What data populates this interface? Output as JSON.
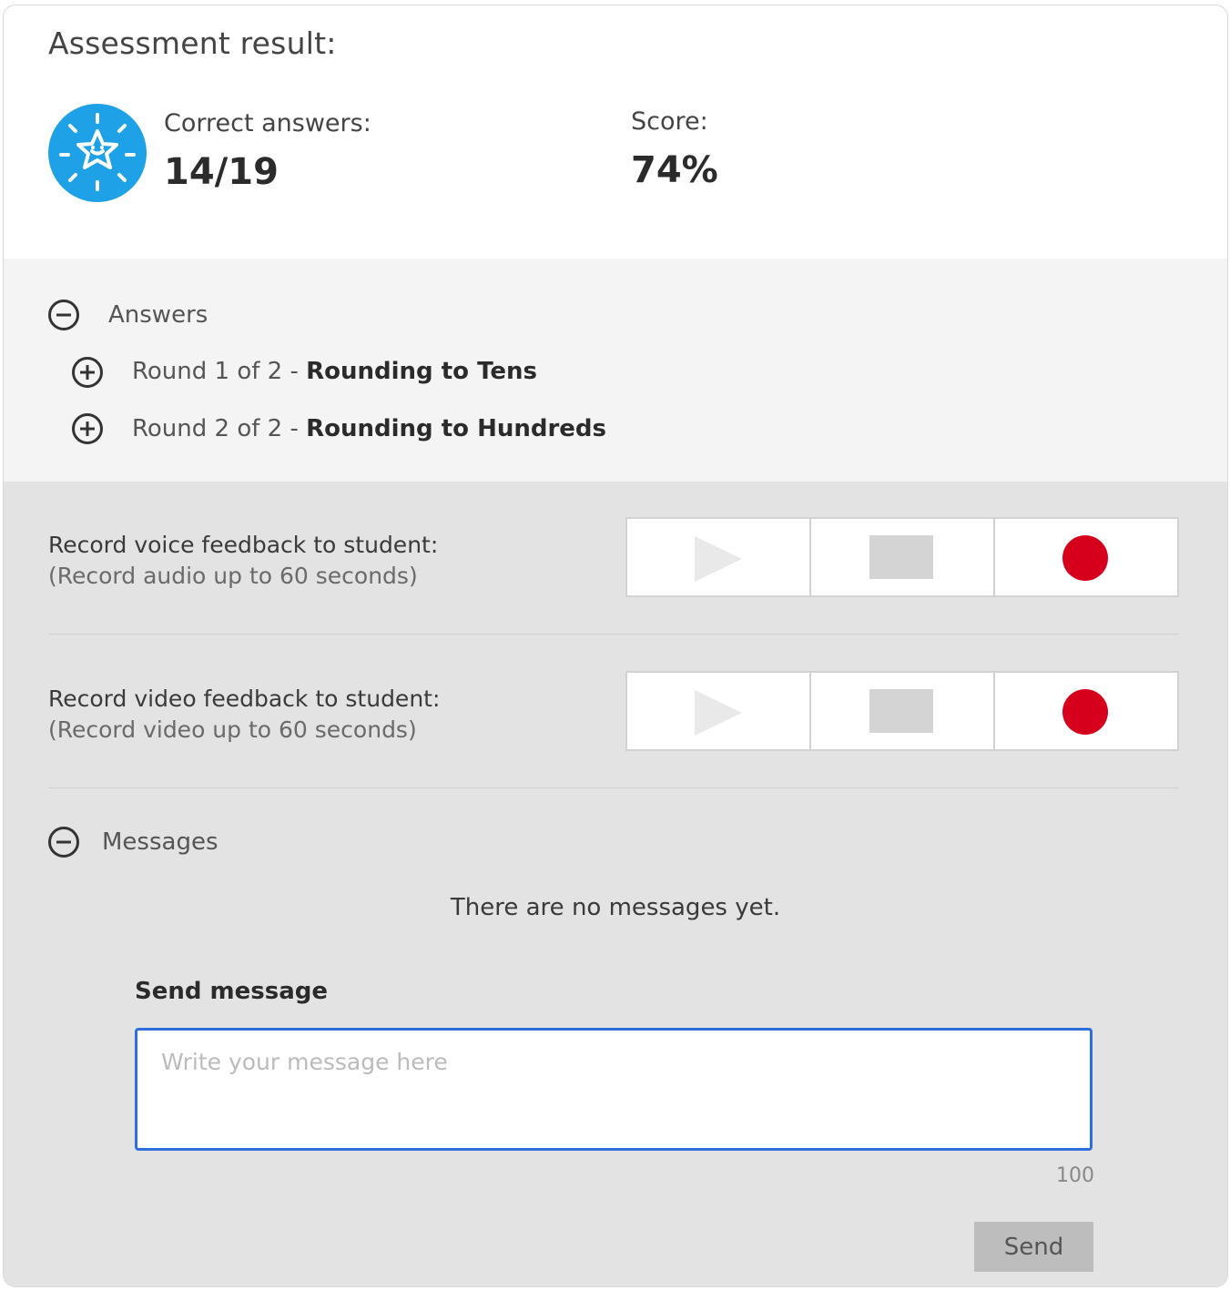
{
  "header": {
    "title": "Assessment result:"
  },
  "stats": {
    "correct_label": "Correct answers:",
    "correct_value": "14/19",
    "score_label": "Score:",
    "score_value": "74%"
  },
  "answers": {
    "label": "Answers",
    "rounds": [
      {
        "prefix": "Round 1 of 2 - ",
        "name": "Rounding to Tens"
      },
      {
        "prefix": "Round 2 of 2 - ",
        "name": "Rounding to Hundreds"
      }
    ]
  },
  "feedback": {
    "voice": {
      "label": "Record voice feedback to student:",
      "sub": "(Record audio up to 60 seconds)"
    },
    "video": {
      "label": "Record video feedback to student:",
      "sub": "(Record video up to 60 seconds)"
    }
  },
  "messages": {
    "label": "Messages",
    "empty_text": "There are no messages yet.",
    "send_heading": "Send message",
    "placeholder": "Write your message here",
    "counter": "100",
    "send_label": "Send"
  },
  "colors": {
    "badge": "#1ea1e6",
    "record": "#d6001c",
    "input_border": "#2f6fdc"
  },
  "icons": [
    "star-badge-icon",
    "minus-circle-icon",
    "plus-circle-icon",
    "play-icon",
    "stop-icon",
    "record-icon"
  ]
}
